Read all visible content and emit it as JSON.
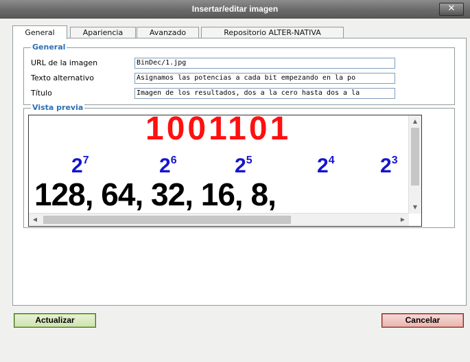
{
  "window": {
    "title": "Insertar/editar imagen",
    "close_glyph": "✕"
  },
  "tabs": [
    {
      "label": "General",
      "active": true
    },
    {
      "label": "Apariencia",
      "active": false
    },
    {
      "label": "Avanzado",
      "active": false
    },
    {
      "label": "Repositorio ALTER-NATIVA",
      "active": false
    }
  ],
  "general": {
    "legend": "General",
    "url": {
      "label": "URL de la imagen",
      "value": "BinDec/1.jpg"
    },
    "alt": {
      "label": "Texto alternativo",
      "value": "Asignamos las potencias a cada bit empezando en la po"
    },
    "title": {
      "label": "Título",
      "value": "Imagen de los resultados, dos a la cero hasta dos a la"
    }
  },
  "preview": {
    "legend": "Vista previa",
    "binary": "1001101",
    "powers": [
      {
        "base": "2",
        "exp": "7"
      },
      {
        "base": "2",
        "exp": "6"
      },
      {
        "base": "2",
        "exp": "5"
      },
      {
        "base": "2",
        "exp": "4"
      },
      {
        "base": "2",
        "exp": "3"
      }
    ],
    "values": "128, 64, 32, 16, 8,"
  },
  "buttons": {
    "update": "Actualizar",
    "cancel": "Cancelar"
  },
  "colors": {
    "legend": "#2b6fb6",
    "binary": "#ff1010",
    "powers": "#1515d0"
  }
}
